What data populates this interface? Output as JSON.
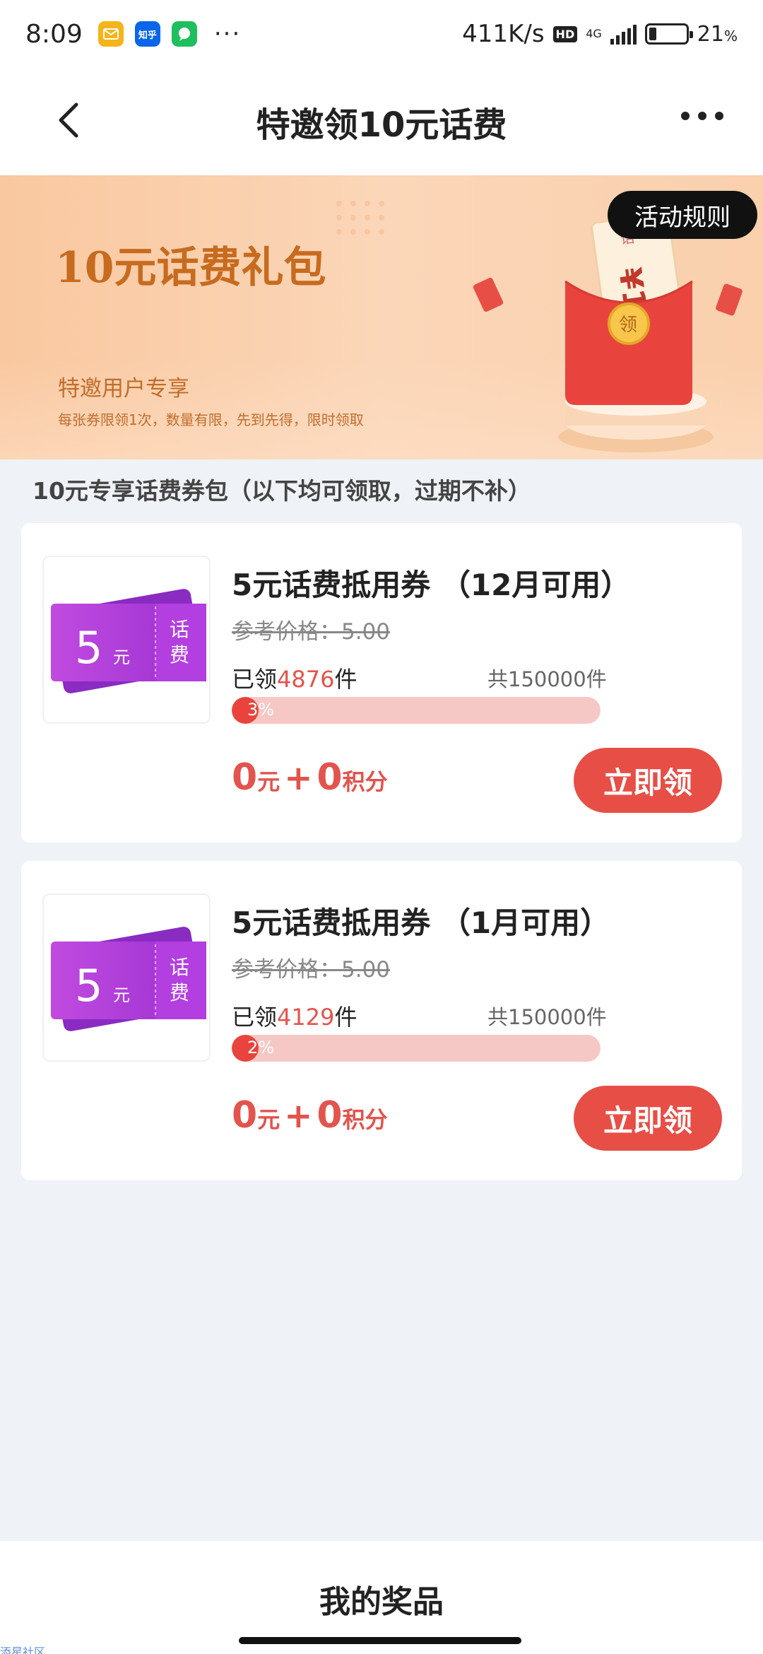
{
  "status_bar": {
    "time": "8:09",
    "zhihu_badge": "知乎",
    "overflow": "···",
    "net_speed": "411K/s",
    "hd": "HD",
    "network": "4G",
    "battery_level": "21",
    "battery_unit": "%",
    "battery_fraction": 0.21
  },
  "nav": {
    "title": "特邀领10元话费"
  },
  "banner": {
    "title": "10元话费礼包",
    "subtitle": "特邀用户专享",
    "note": "每张券限领1次，数量有限，先到先得，限时领取",
    "rules_button": "活动规则"
  },
  "section_heading": "10元专享话费券包（以下均可领取，过期不补）",
  "coupons": [
    {
      "title": "5元话费抵用券 （12月可用）",
      "ref_price": "参考价格：5.00",
      "claimed_prefix": "已领",
      "claimed_count": "4876",
      "claimed_suffix": "件",
      "total": "共150000件",
      "progress_label": "3%",
      "progress_fraction": 0.03,
      "price_yuan": "0",
      "price_yuan_unit": "元",
      "price_plus": "+",
      "price_points": "0",
      "price_points_unit": "积分",
      "button": "立即领",
      "ticket_value": "5",
      "ticket_unit": "元",
      "ticket_tag_1": "话",
      "ticket_tag_2": "费"
    },
    {
      "title": "5元话费抵用券 （1月可用）",
      "ref_price": "参考价格：5.00",
      "claimed_prefix": "已领",
      "claimed_count": "4129",
      "claimed_suffix": "件",
      "total": "共150000件",
      "progress_label": "2%",
      "progress_fraction": 0.02,
      "price_yuan": "0",
      "price_yuan_unit": "元",
      "price_plus": "+",
      "price_points": "0",
      "price_points_unit": "积分",
      "button": "立即领",
      "ticket_value": "5",
      "ticket_unit": "元",
      "ticket_tag_1": "话",
      "ticket_tag_2": "费"
    }
  ],
  "bottom": {
    "my_prizes": "我的奖品",
    "watermark": "添星社区"
  },
  "gift_art": {
    "ticket_text": "¥10",
    "coin_text": "领",
    "corner_text": "话"
  },
  "colors": {
    "accent_red": "#e74f46",
    "banner_text": "#c76b1f",
    "coupon_purple": "#a633d6"
  }
}
